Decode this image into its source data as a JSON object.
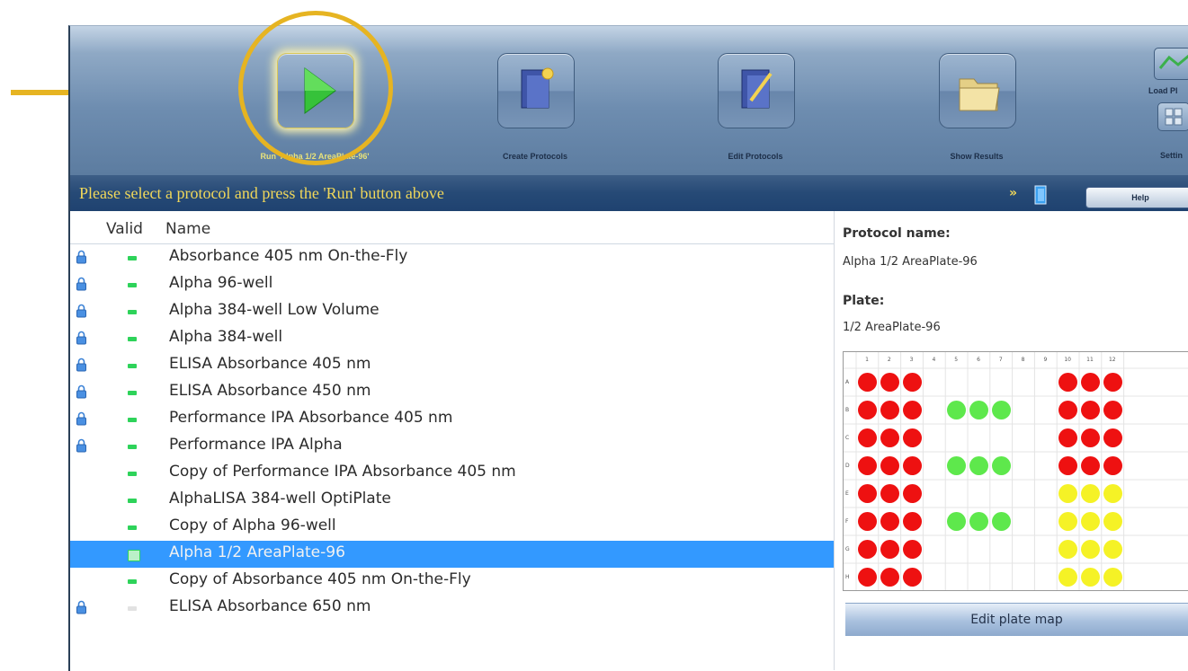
{
  "toolbar": {
    "buttons": [
      {
        "label": "Run 'Alpha 1/2 AreaPlate-96'",
        "icon": "play-icon"
      },
      {
        "label": "Create Protocols",
        "icon": "create-protocol-icon"
      },
      {
        "label": "Edit Protocols",
        "icon": "edit-protocol-icon"
      },
      {
        "label": "Show Results",
        "icon": "folder-icon"
      },
      {
        "label": "Load Pl",
        "icon": "load-plate-icon"
      },
      {
        "label": "Settin",
        "icon": "settings-icon"
      }
    ]
  },
  "status": {
    "message": "Please select a protocol and press the 'Run' button above",
    "arrows": "»",
    "help_label": "Help"
  },
  "list": {
    "headers": {
      "valid": "Valid",
      "name": "Name"
    },
    "rows": [
      {
        "name": "Absorbance 405 nm On-the-Fly",
        "locked": true,
        "valid": true
      },
      {
        "name": "Alpha 96-well",
        "locked": true,
        "valid": true
      },
      {
        "name": "Alpha 384-well Low Volume",
        "locked": true,
        "valid": true
      },
      {
        "name": "Alpha 384-well",
        "locked": true,
        "valid": true
      },
      {
        "name": "ELISA Absorbance 405 nm",
        "locked": true,
        "valid": true
      },
      {
        "name": "ELISA Absorbance 450 nm",
        "locked": true,
        "valid": true
      },
      {
        "name": "Performance IPA Absorbance 405 nm",
        "locked": true,
        "valid": true
      },
      {
        "name": "Performance IPA Alpha",
        "locked": true,
        "valid": true
      },
      {
        "name": "Copy of Performance IPA Absorbance 405 nm",
        "locked": false,
        "valid": true
      },
      {
        "name": "AlphaLISA 384-well OptiPlate",
        "locked": false,
        "valid": true
      },
      {
        "name": "Copy of Alpha 96-well",
        "locked": false,
        "valid": true
      },
      {
        "name": "Alpha 1/2 AreaPlate-96",
        "locked": false,
        "valid": true,
        "selected": true
      },
      {
        "name": "Copy of Absorbance 405 nm On-the-Fly",
        "locked": false,
        "valid": true
      },
      {
        "name": "ELISA Absorbance 650 nm",
        "locked": true,
        "valid": false
      }
    ]
  },
  "details": {
    "protocol_name_label": "Protocol name:",
    "protocol_name": "Alpha 1/2 AreaPlate-96",
    "plate_label": "Plate:",
    "plate": "1/2 AreaPlate-96",
    "edit_plate_map_label": "Edit plate map"
  },
  "plate_map": {
    "columns": [
      "1",
      "2",
      "3",
      "4",
      "5",
      "6",
      "7",
      "8",
      "9",
      "10",
      "11",
      "12"
    ],
    "rows": [
      "A",
      "B",
      "C",
      "D",
      "E",
      "F",
      "G",
      "H"
    ],
    "colors": {
      "red": "#ee1111",
      "green": "#5ee84c",
      "yellow": "#f5f226"
    },
    "wells": [
      [
        "red",
        "red",
        "red",
        "",
        "",
        "",
        "",
        "",
        "",
        "red",
        "red",
        "red"
      ],
      [
        "red",
        "red",
        "red",
        "",
        "green",
        "green",
        "green",
        "",
        "",
        "red",
        "red",
        "red"
      ],
      [
        "red",
        "red",
        "red",
        "",
        "",
        "",
        "",
        "",
        "",
        "red",
        "red",
        "red"
      ],
      [
        "red",
        "red",
        "red",
        "",
        "green",
        "green",
        "green",
        "",
        "",
        "red",
        "red",
        "red"
      ],
      [
        "red",
        "red",
        "red",
        "",
        "",
        "",
        "",
        "",
        "",
        "yellow",
        "yellow",
        "yellow"
      ],
      [
        "red",
        "red",
        "red",
        "",
        "green",
        "green",
        "green",
        "",
        "",
        "yellow",
        "yellow",
        "yellow"
      ],
      [
        "red",
        "red",
        "red",
        "",
        "",
        "",
        "",
        "",
        "",
        "yellow",
        "yellow",
        "yellow"
      ],
      [
        "red",
        "red",
        "red",
        "",
        "",
        "",
        "",
        "",
        "",
        "yellow",
        "yellow",
        "yellow"
      ]
    ]
  },
  "annotation": {
    "color": "#e6b422"
  }
}
